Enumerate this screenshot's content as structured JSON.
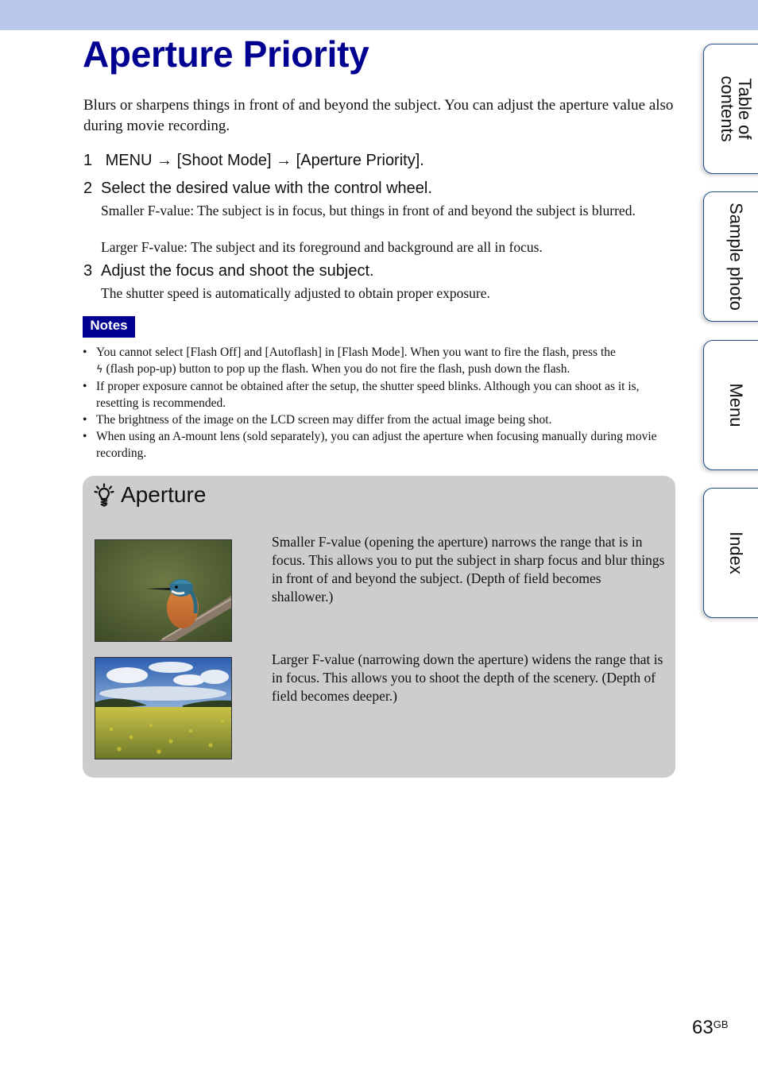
{
  "page": {
    "title": "Aperture Priority",
    "intro": "Blurs or sharpens things in front of and beyond the subject. You can adjust the aperture value also during movie recording.",
    "steps": [
      {
        "number": "1",
        "parts": [
          "MENU",
          "[Shoot Mode]",
          "[Aperture Priority]."
        ],
        "arrow": "→"
      },
      {
        "number": "2",
        "text": "Select the desired value with the control wheel.",
        "details": [
          "Smaller F-value: The subject is in focus, but things in front of and beyond the subject is blurred.",
          "Larger F-value: The subject and its foreground and background are all in focus."
        ]
      },
      {
        "number": "3",
        "text": "Adjust the focus and shoot the subject.",
        "details": [
          "The shutter speed is automatically adjusted to obtain proper exposure."
        ]
      }
    ],
    "notes": {
      "label": "Notes",
      "bullet": "•",
      "items": [
        {
          "before_icon": "You cannot select [Flash Off] and [Autoflash] in [Flash Mode]. When you want to fire the flash, press the ",
          "icon": "flash-icon",
          "icon_glyph": "ϟ",
          "after_icon": " (flash pop-up) button to pop up the flash. When you do not fire the flash, push down the flash."
        },
        {
          "text": "If proper exposure cannot be obtained after the setup, the shutter speed blinks. Although you can shoot as it is, resetting is recommended."
        },
        {
          "text": "The brightness of the image on the LCD screen may differ from the actual image being shot."
        },
        {
          "text": "When using an A-mount lens (sold separately), you can adjust the aperture when focusing manually during movie recording."
        }
      ]
    },
    "tip": {
      "icon": "lightbulb-hint-icon",
      "title": "Aperture",
      "items": [
        {
          "image": "kingfisher-photo",
          "text": "Smaller F-value (opening the aperture) narrows the range that is in focus. This allows you to put the subject in sharp focus and blur things in front of and beyond the subject. (Depth of field becomes shallower.)"
        },
        {
          "image": "sunflower-field-photo",
          "text": "Larger F-value (narrowing down the aperture) widens the range that is in focus. This allows you to shoot the depth of the scenery. (Depth of field becomes deeper.)"
        }
      ]
    },
    "side_tabs": [
      {
        "label_line1": "Table of",
        "label_line2": "contents"
      },
      {
        "label_line1": "Sample photo"
      },
      {
        "label_line1": "Menu"
      },
      {
        "label_line1": "Index"
      }
    ],
    "page_number": "63",
    "page_suffix": "GB"
  },
  "colors": {
    "title_blue": "#000091",
    "top_band": "#b8c7eb",
    "tip_background": "#cdcdcd",
    "tab_border": "#1f4e8c"
  }
}
